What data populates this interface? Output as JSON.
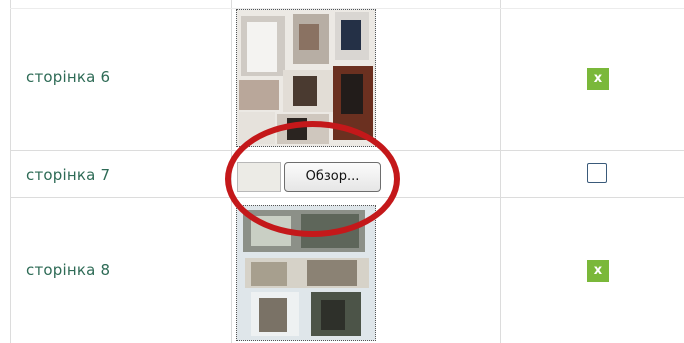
{
  "rows": [
    {
      "label": "сторінка 6"
    },
    {
      "label": "сторінка 7"
    },
    {
      "label": "сторінка 8"
    }
  ],
  "delete_badge": "x",
  "browse_button": "Обзор...",
  "colors": {
    "label": "#2e6b56",
    "badge": "#7ab83a",
    "highlight_circle": "#c4181a",
    "grid": "#dcdcdc"
  }
}
